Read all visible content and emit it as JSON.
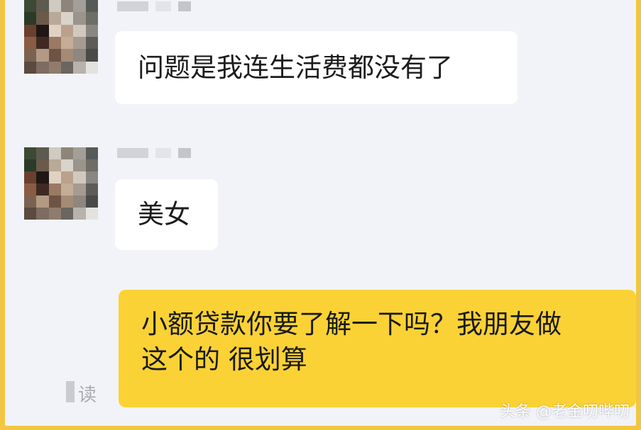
{
  "messages": [
    {
      "side": "left",
      "text": "问题是我连生活费都没有了"
    },
    {
      "side": "left",
      "text": "美女"
    },
    {
      "side": "right",
      "lines": [
        "小额贷款你要了解一下吗？我朋友做",
        "这个的 很划算"
      ]
    }
  ],
  "read_status": "读",
  "watermark": "头条 @老金叨哔叨",
  "colors": {
    "outer_border": "#f1c741",
    "chat_background": "#f2f3f8",
    "incoming_bubble": "#ffffff",
    "outgoing_bubble": "#fbd235"
  }
}
